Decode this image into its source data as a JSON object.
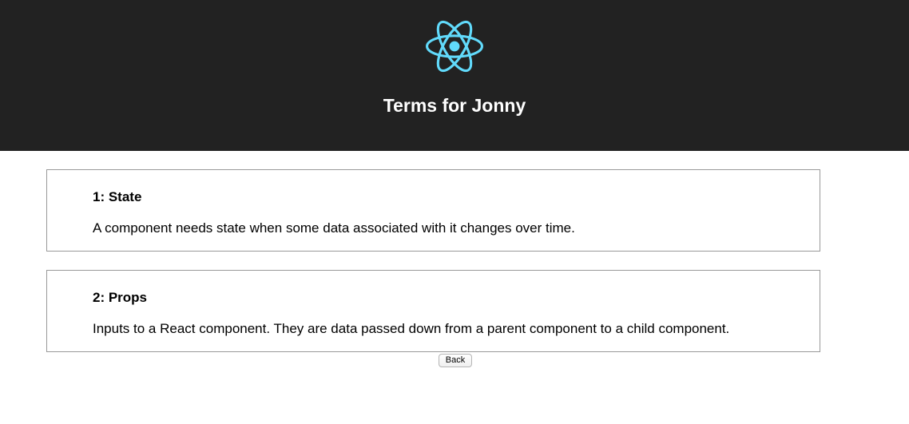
{
  "header": {
    "logo_icon": "react-logo-icon",
    "logo_color": "#61dafb",
    "title": "Terms for Jonny",
    "background": "#222222"
  },
  "terms": [
    {
      "heading": "1: State",
      "definition": "A component needs state when some data associated with it changes over time."
    },
    {
      "heading": "2: Props",
      "definition": "Inputs to a React component. They are data passed down from a parent component to a child component."
    }
  ],
  "actions": {
    "back_label": "Back"
  }
}
